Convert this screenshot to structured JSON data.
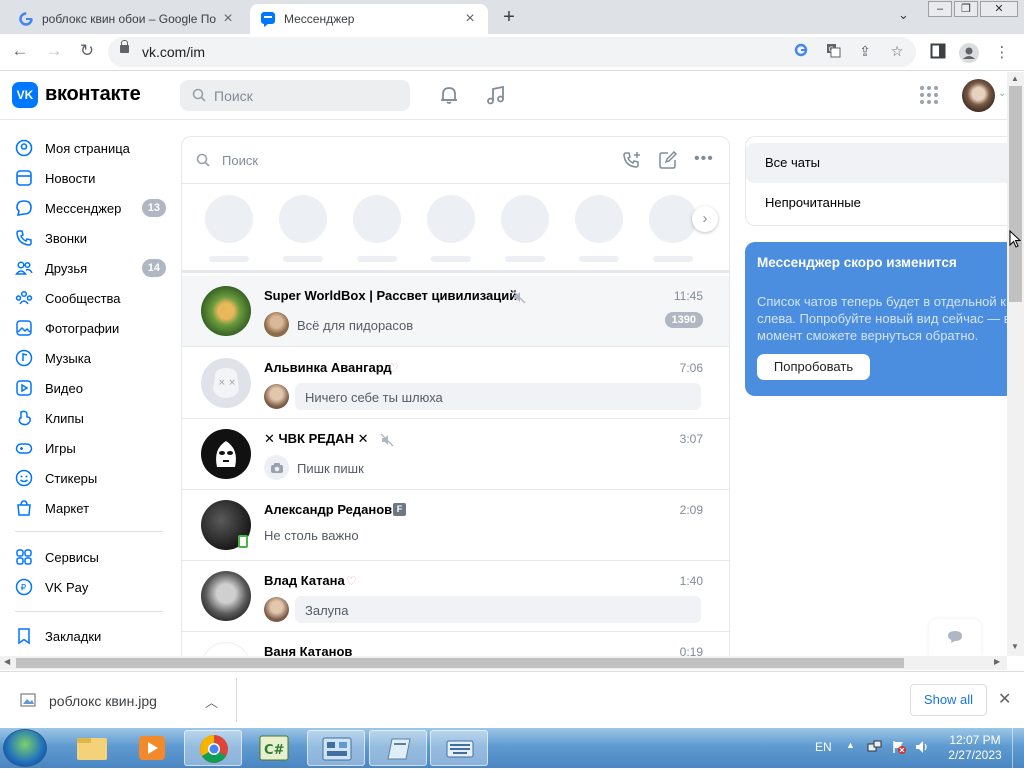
{
  "browser": {
    "tabs": [
      {
        "title": "роблокс квин обои – Google По",
        "active": false
      },
      {
        "title": "Мессенджер",
        "active": true
      }
    ],
    "url": "vk.com/im"
  },
  "vk": {
    "brand": "вконтакте",
    "search_placeholder": "Поиск",
    "menu": [
      {
        "label": "Моя страница",
        "icon": "user-icon"
      },
      {
        "label": "Новости",
        "icon": "news-icon"
      },
      {
        "label": "Мессенджер",
        "icon": "message-icon",
        "count": "13"
      },
      {
        "label": "Звонки",
        "icon": "phone-icon"
      },
      {
        "label": "Друзья",
        "icon": "friends-icon",
        "count": "14"
      },
      {
        "label": "Сообщества",
        "icon": "communities-icon"
      },
      {
        "label": "Фотографии",
        "icon": "photos-icon"
      },
      {
        "label": "Музыка",
        "icon": "music-icon"
      },
      {
        "label": "Видео",
        "icon": "video-icon"
      },
      {
        "label": "Клипы",
        "icon": "clips-icon"
      },
      {
        "label": "Игры",
        "icon": "games-icon"
      },
      {
        "label": "Стикеры",
        "icon": "stickers-icon"
      },
      {
        "label": "Маркет",
        "icon": "market-icon"
      },
      {
        "label": "Сервисы",
        "icon": "services-icon"
      },
      {
        "label": "VK Pay",
        "icon": "vkpay-icon"
      },
      {
        "label": "Закладки",
        "icon": "bookmarks-icon"
      }
    ],
    "chat_search_placeholder": "Поиск",
    "chats": [
      {
        "name": "Super WorldBox | Рассвет цивилизаций",
        "time": "11:45",
        "message": "Всё для пидорасов",
        "unread": "1390",
        "muted": true
      },
      {
        "name": "Альвинка Авангард",
        "time": "7:06",
        "message": "Ничего себе ты шлюха"
      },
      {
        "name": "✕ ЧВК РЕДАН ✕",
        "time": "3:07",
        "message": "Пишк пишк",
        "muted": true
      },
      {
        "name": "Александр Реданов",
        "name_badge": "F",
        "time": "2:09",
        "message": "Не столь важно"
      },
      {
        "name": "Влад Катана",
        "time": "1:40",
        "message": "Залупа"
      },
      {
        "name": "Ваня Катанов",
        "time": "0:19"
      }
    ],
    "filters": [
      "Все чаты",
      "Непрочитанные"
    ],
    "promo": {
      "title": "Мессенджер скоро изменится",
      "text": "Список чатов теперь будет в отдельной к\nслева. Попробуйте новый вид сейчас — в\nмомент сможете вернуться обратно.",
      "button": "Попробовать"
    }
  },
  "download": {
    "filename": "роблокс квин.jpg",
    "show_all": "Show all"
  },
  "taskbar": {
    "lang": "EN",
    "time": "12:07 PM",
    "date": "2/27/2023"
  }
}
